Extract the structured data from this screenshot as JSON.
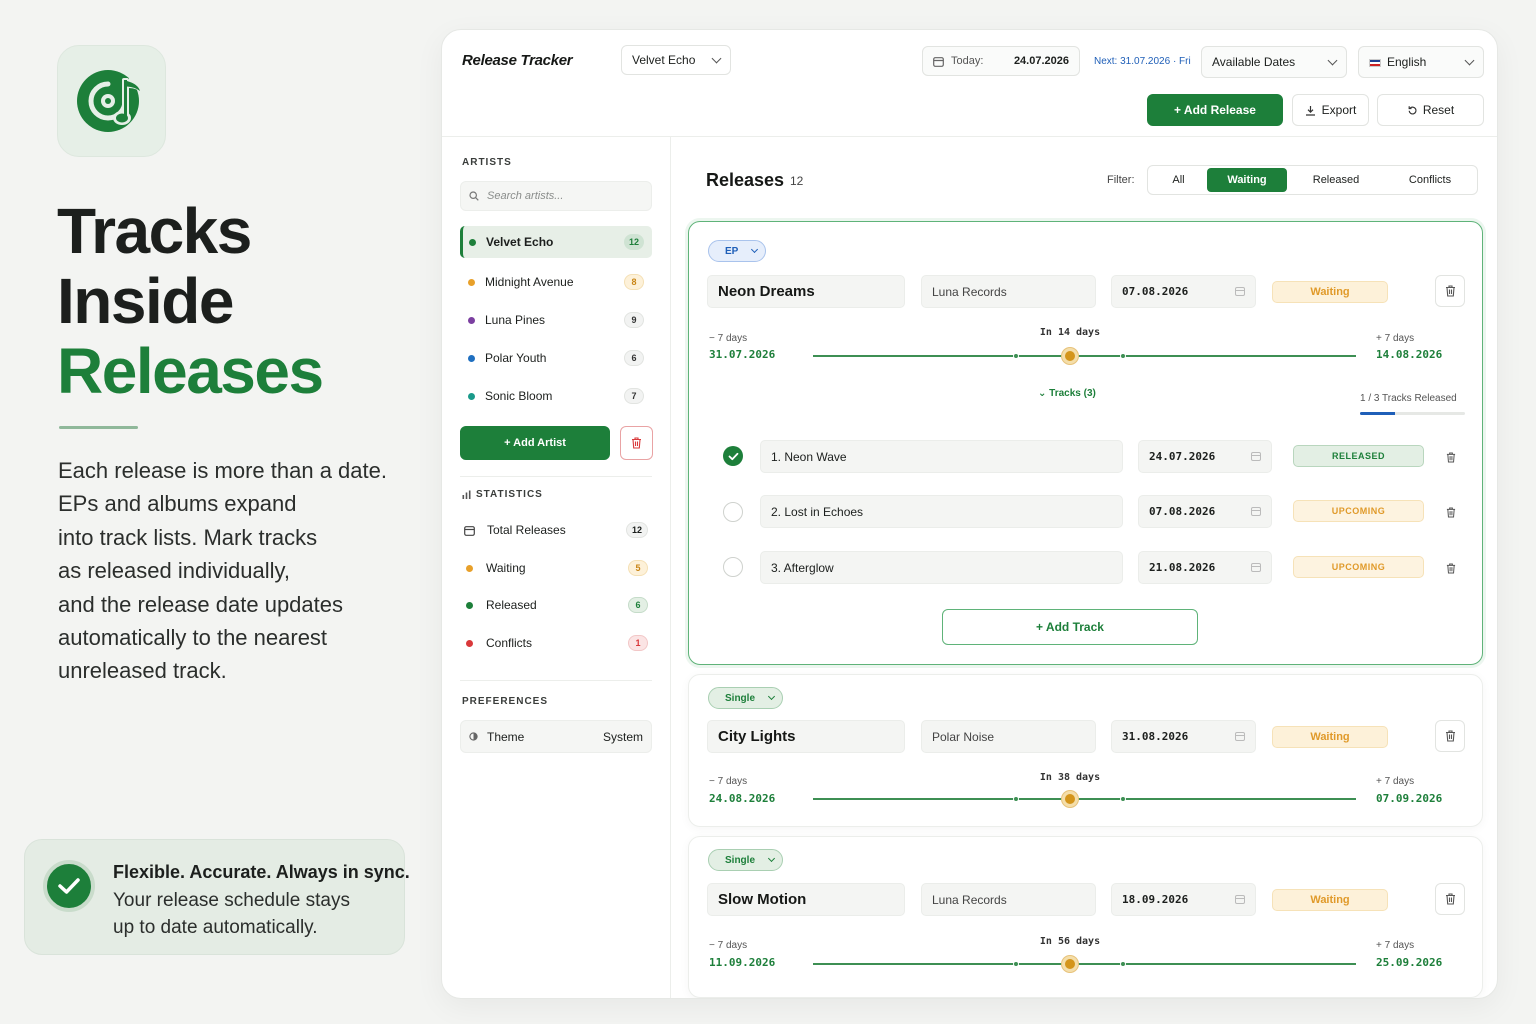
{
  "hero": {
    "title_line1": "Tracks",
    "title_line2": "Inside",
    "title_line3": "Releases",
    "copy_lines": [
      "Each release is more than a date.",
      "EPs and albums expand",
      "into track lists. Mark tracks",
      "as released individually,",
      "and the release date updates",
      "automatically to the nearest",
      "unreleased track."
    ],
    "promo_title": "Flexible. Accurate. Always in sync.",
    "promo_lines": [
      "Your release schedule stays",
      "up to date automatically."
    ]
  },
  "header": {
    "brand": "Release Tracker",
    "artist_select": "Velvet Echo",
    "today_label": "Today:",
    "today_value": "24.07.2026",
    "next_label": "Next: 31.07.2026 · Fri",
    "dates_select": "Available Dates",
    "language_select": "English",
    "add_release": "+ Add Release",
    "export": "Export",
    "reset": "Reset"
  },
  "sidebar": {
    "artists_heading": "ARTISTS",
    "search_placeholder": "Search artists...",
    "artists": [
      {
        "name": "Velvet Echo",
        "count": "12",
        "color": "#1d7f3a"
      },
      {
        "name": "Midnight Avenue",
        "count": "8",
        "color": "#e8a02a"
      },
      {
        "name": "Luna Pines",
        "count": "9",
        "color": "#7b3fa0"
      },
      {
        "name": "Polar Youth",
        "count": "6",
        "color": "#1f6fc0"
      },
      {
        "name": "Sonic Bloom",
        "count": "7",
        "color": "#1a9a8a"
      }
    ],
    "add_artist": "+ Add Artist",
    "statistics_heading": "STATISTICS",
    "stats": [
      {
        "label": "Total Releases",
        "count": "12"
      },
      {
        "label": "Waiting",
        "count": "5"
      },
      {
        "label": "Released",
        "count": "6"
      },
      {
        "label": "Conflicts",
        "count": "1"
      }
    ],
    "preferences_heading": "PREFERENCES",
    "theme_label": "Theme",
    "theme_value": "System"
  },
  "main": {
    "title": "Releases",
    "count": "12",
    "filter_label": "Filter:",
    "filters": [
      "All",
      "Waiting",
      "Released",
      "Conflicts"
    ],
    "active_filter": "Waiting"
  },
  "releases": [
    {
      "type": "EP",
      "title": "Neon Dreams",
      "label": "Luna Records",
      "date": "07.08.2026",
      "status": "Waiting",
      "minus_label": "− 7 days",
      "minus_date": "31.07.2026",
      "in_days": "In 14 days",
      "plus_label": "+ 7 days",
      "plus_date": "14.08.2026",
      "tracks_toggle": "⌄ Tracks (3)",
      "tracks_progress": "1 / 3 Tracks Released",
      "tracks_released_fraction": 0.333,
      "tracks": [
        {
          "title": "1. Neon Wave",
          "date": "24.07.2026",
          "status": "RELEASED",
          "done": true
        },
        {
          "title": "2. Lost in Echoes",
          "date": "07.08.2026",
          "status": "UPCOMING",
          "done": false
        },
        {
          "title": "3. Afterglow",
          "date": "21.08.2026",
          "status": "UPCOMING",
          "done": false
        }
      ],
      "add_track": "+ Add Track"
    },
    {
      "type": "Single",
      "title": "City Lights",
      "label": "Polar Noise",
      "date": "31.08.2026",
      "status": "Waiting",
      "minus_label": "− 7 days",
      "minus_date": "24.08.2026",
      "in_days": "In 38 days",
      "plus_label": "+ 7 days",
      "plus_date": "07.09.2026"
    },
    {
      "type": "Single",
      "title": "Slow Motion",
      "label": "Luna Records",
      "date": "18.09.2026",
      "status": "Waiting",
      "minus_label": "− 7 days",
      "minus_date": "11.09.2026",
      "in_days": "In 56 days",
      "plus_label": "+ 7 days",
      "plus_date": "25.09.2026"
    }
  ],
  "colors": {
    "brand_green": "#1d7f3a",
    "waiting_amber": "#e09a2a",
    "link_blue": "#1f5fb8",
    "conflict_red": "#d9383a"
  }
}
